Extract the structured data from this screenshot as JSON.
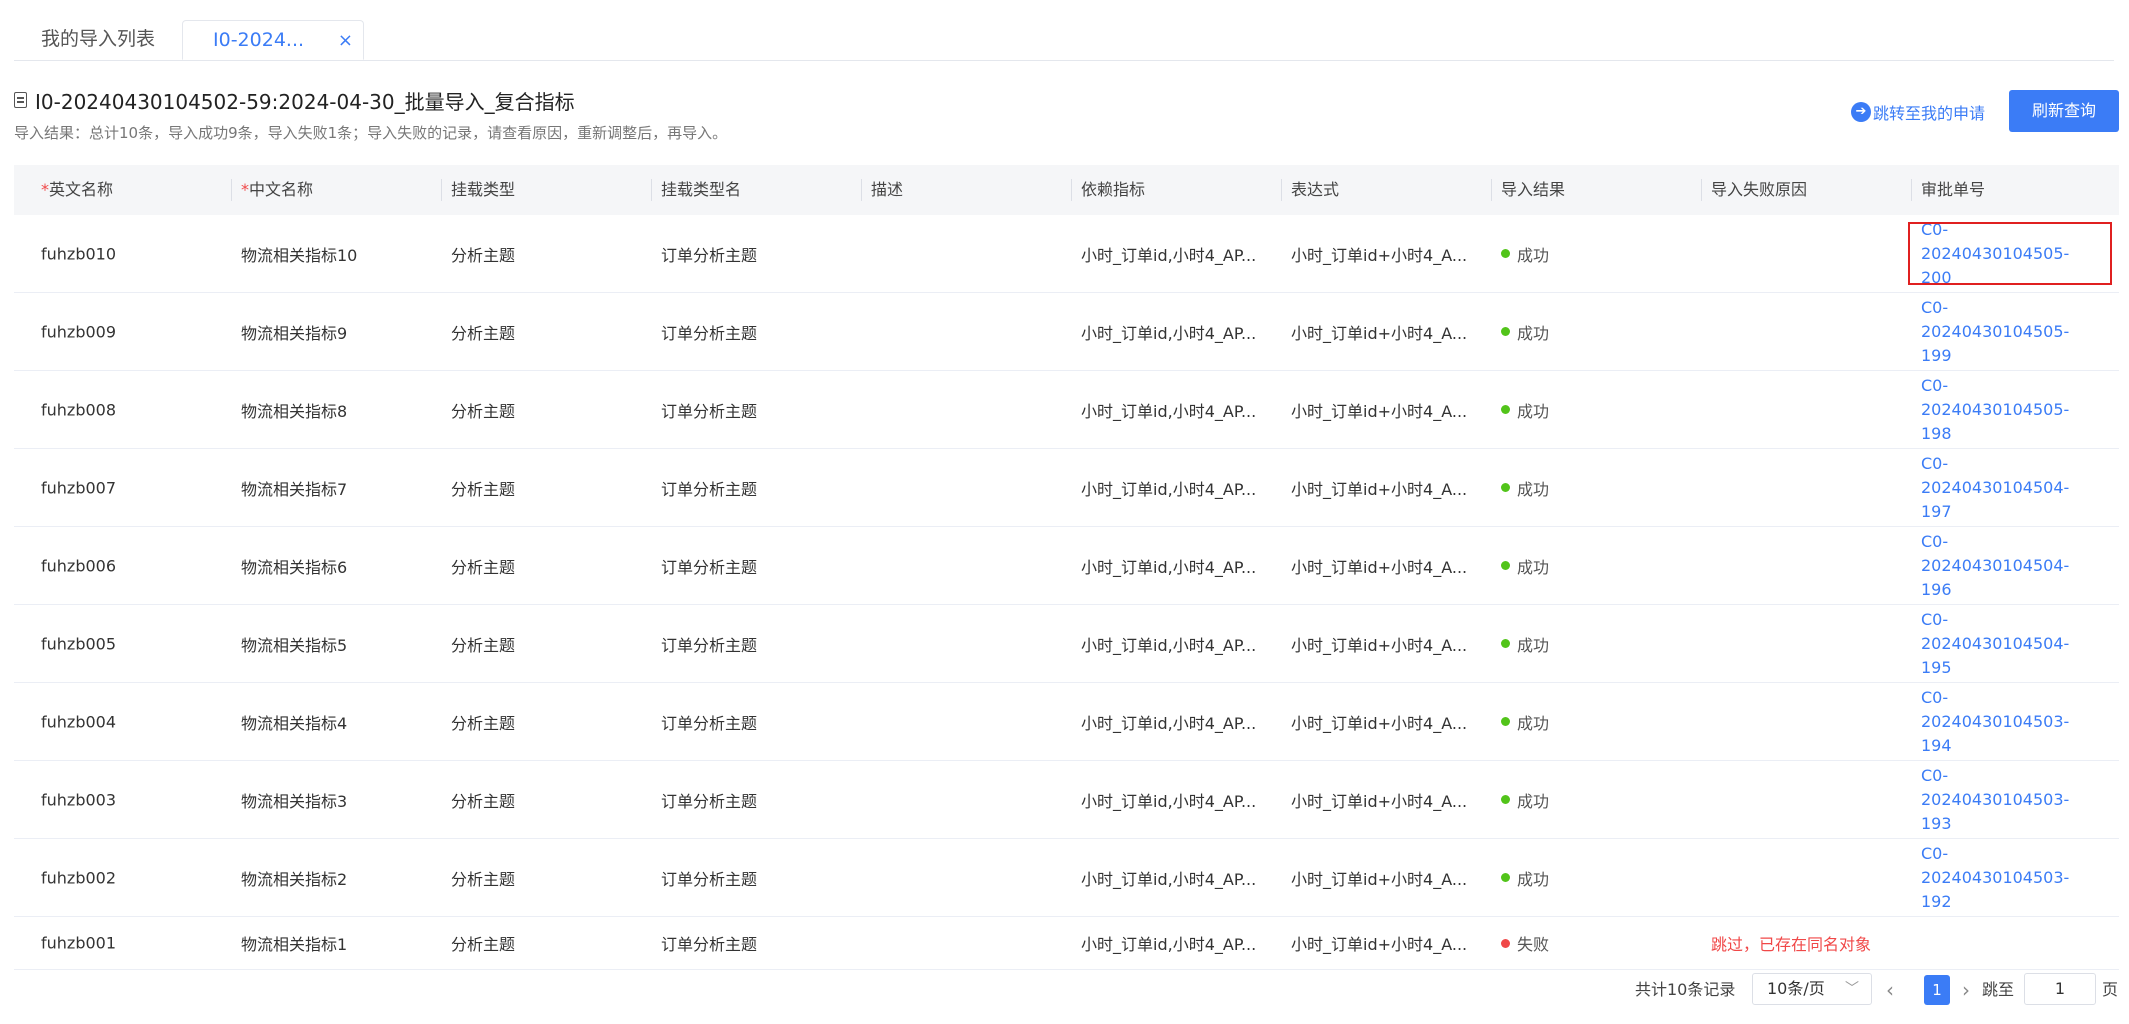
{
  "tabs": [
    {
      "label": "我的导入列表"
    },
    {
      "label": "I0-2024...",
      "close": "×"
    }
  ],
  "header": {
    "title": "I0-20240430104502-59:2024-04-30_批量导入_复合指标",
    "summary": "导入结果：总计10条，导入成功9条，导入失败1条；导入失败的记录，请查看原因，重新调整后，再导入。",
    "jump_label": "跳转至我的申请",
    "refresh_label": "刷新查询"
  },
  "table": {
    "required_mark": "*",
    "columns": [
      "英文名称",
      "中文名称",
      "挂载类型",
      "挂载类型名",
      "描述",
      "依赖指标",
      "表达式",
      "导入结果",
      "导入失败原因",
      "审批单号"
    ],
    "rows": [
      {
        "en": "fuhzb010",
        "cn": "物流相关指标10",
        "type": "分析主题",
        "type_name": "订单分析主题",
        "desc": "",
        "dep": "小时_订单id,小时4_AP...",
        "expr": "小时_订单id+小时4_A...",
        "result": "成功",
        "reason": "",
        "approval": "C0-20240430104505-200"
      },
      {
        "en": "fuhzb009",
        "cn": "物流相关指标9",
        "type": "分析主题",
        "type_name": "订单分析主题",
        "desc": "",
        "dep": "小时_订单id,小时4_AP...",
        "expr": "小时_订单id+小时4_A...",
        "result": "成功",
        "reason": "",
        "approval": "C0-20240430104505-199"
      },
      {
        "en": "fuhzb008",
        "cn": "物流相关指标8",
        "type": "分析主题",
        "type_name": "订单分析主题",
        "desc": "",
        "dep": "小时_订单id,小时4_AP...",
        "expr": "小时_订单id+小时4_A...",
        "result": "成功",
        "reason": "",
        "approval": "C0-20240430104505-198"
      },
      {
        "en": "fuhzb007",
        "cn": "物流相关指标7",
        "type": "分析主题",
        "type_name": "订单分析主题",
        "desc": "",
        "dep": "小时_订单id,小时4_AP...",
        "expr": "小时_订单id+小时4_A...",
        "result": "成功",
        "reason": "",
        "approval": "C0-20240430104504-197"
      },
      {
        "en": "fuhzb006",
        "cn": "物流相关指标6",
        "type": "分析主题",
        "type_name": "订单分析主题",
        "desc": "",
        "dep": "小时_订单id,小时4_AP...",
        "expr": "小时_订单id+小时4_A...",
        "result": "成功",
        "reason": "",
        "approval": "C0-20240430104504-196"
      },
      {
        "en": "fuhzb005",
        "cn": "物流相关指标5",
        "type": "分析主题",
        "type_name": "订单分析主题",
        "desc": "",
        "dep": "小时_订单id,小时4_AP...",
        "expr": "小时_订单id+小时4_A...",
        "result": "成功",
        "reason": "",
        "approval": "C0-20240430104504-195"
      },
      {
        "en": "fuhzb004",
        "cn": "物流相关指标4",
        "type": "分析主题",
        "type_name": "订单分析主题",
        "desc": "",
        "dep": "小时_订单id,小时4_AP...",
        "expr": "小时_订单id+小时4_A...",
        "result": "成功",
        "reason": "",
        "approval": "C0-20240430104503-194"
      },
      {
        "en": "fuhzb003",
        "cn": "物流相关指标3",
        "type": "分析主题",
        "type_name": "订单分析主题",
        "desc": "",
        "dep": "小时_订单id,小时4_AP...",
        "expr": "小时_订单id+小时4_A...",
        "result": "成功",
        "reason": "",
        "approval": "C0-20240430104503-193"
      },
      {
        "en": "fuhzb002",
        "cn": "物流相关指标2",
        "type": "分析主题",
        "type_name": "订单分析主题",
        "desc": "",
        "dep": "小时_订单id,小时4_AP...",
        "expr": "小时_订单id+小时4_A...",
        "result": "成功",
        "reason": "",
        "approval": "C0-20240430104503-192"
      },
      {
        "en": "fuhzb001",
        "cn": "物流相关指标1",
        "type": "分析主题",
        "type_name": "订单分析主题",
        "desc": "",
        "dep": "小时_订单id,小时4_AP...",
        "expr": "小时_订单id+小时4_A...",
        "result": "失败",
        "reason": "跳过，已存在同名对象",
        "approval": ""
      }
    ]
  },
  "pagination": {
    "total_label": "共计10条记录",
    "page_size": "10条/页",
    "current_page": "1",
    "jump_prefix": "跳至",
    "jump_value": "1",
    "jump_suffix": "页"
  },
  "colors": {
    "accent": "#3b7cf6",
    "success": "#52c41a",
    "error": "#f04848",
    "highlight_border": "#e02020"
  },
  "icons": {
    "title": "document-icon",
    "jump": "arrow-right-circle-icon",
    "close": "close-icon",
    "prev": "chevron-left-icon",
    "next": "chevron-right-icon",
    "dropdown": "chevron-down-icon"
  }
}
